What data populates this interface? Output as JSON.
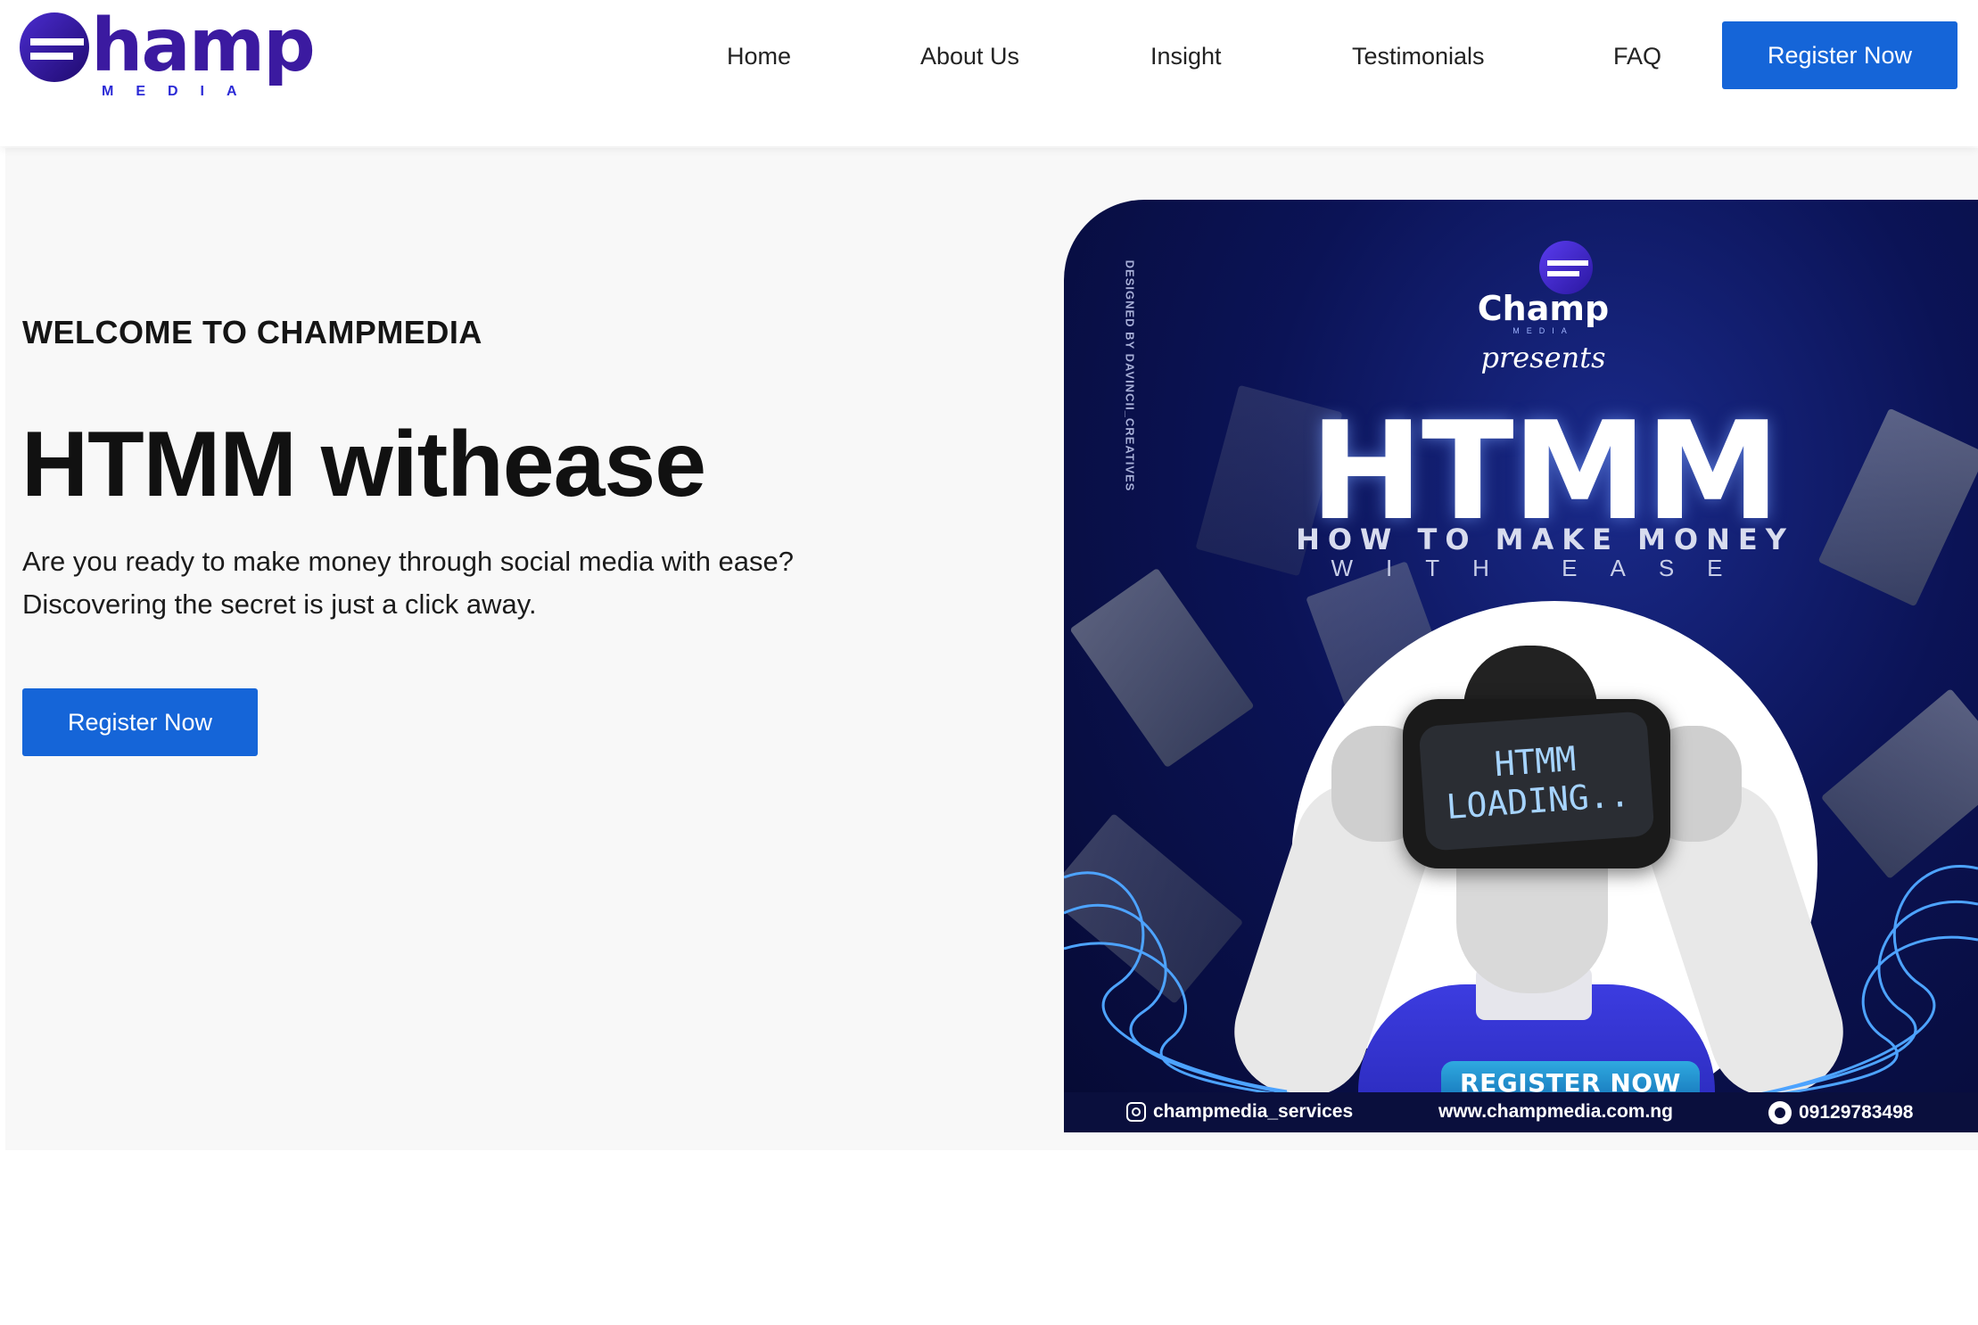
{
  "header": {
    "logo": {
      "word": "hamp",
      "sub": "MEDIA"
    },
    "nav": [
      {
        "label": "Home"
      },
      {
        "label": "About Us"
      },
      {
        "label": "Insight"
      },
      {
        "label": "Testimonials"
      },
      {
        "label": "FAQ"
      }
    ],
    "register_label": "Register Now"
  },
  "hero": {
    "welcome": "WELCOME TO CHAMPMEDIA",
    "headline": "HTMM withease",
    "description_line1": "Are you ready to make money through social media with ease?",
    "description_line2": "Discovering the secret is just a click away.",
    "register_label": "Register Now"
  },
  "flyer": {
    "brand": "Champ",
    "brand_sub": "MEDIA",
    "presents": "presents",
    "title": "HTMM",
    "subtitle": "HOW TO MAKE MONEY",
    "subtitle2": "WITH EASE",
    "vr_line1": "HTMM",
    "vr_line2": "LOADING..",
    "side_credit": "DESIGNED BY DAVINCII_CREATIVES",
    "register_label": "REGISTER NOW",
    "instagram": "champmedia_services",
    "website": "www.champmedia.com.ng",
    "phone": "09129783498"
  },
  "colors": {
    "primary_button": "#1565d8",
    "logo_purple": "#3b1aa0",
    "flyer_navy": "#0b1356",
    "hero_bg": "#f8f8f8"
  },
  "icons": [
    "instagram-icon",
    "whatsapp-icon",
    "champ-logo-icon"
  ]
}
